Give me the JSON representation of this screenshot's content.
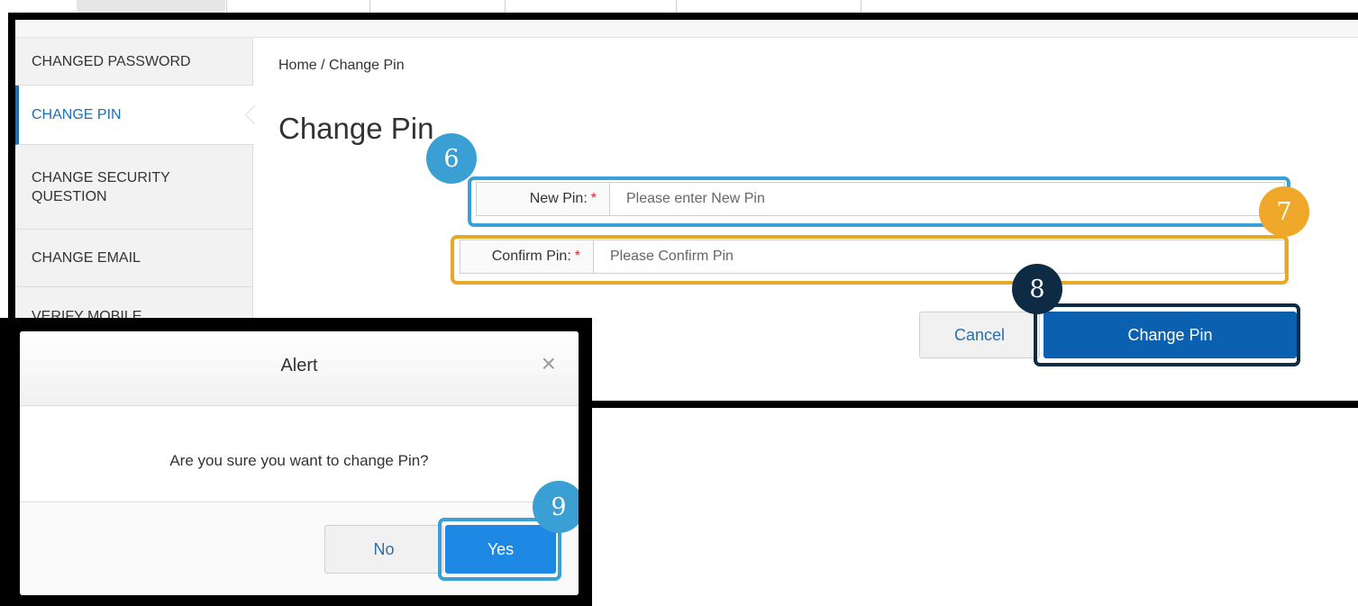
{
  "sidebar": {
    "items": [
      {
        "label": "CHANGED PASSWORD"
      },
      {
        "label": "CHANGE PIN"
      },
      {
        "label": "CHANGE SECURITY QUESTION"
      },
      {
        "label": "CHANGE EMAIL"
      },
      {
        "label": "VERIFY MOBILE"
      }
    ]
  },
  "breadcrumb": "Home / Change Pin",
  "page_title": "Change Pin",
  "form": {
    "new_pin": {
      "label": "New Pin:",
      "required_mark": "*",
      "placeholder": "Please enter New Pin",
      "value": ""
    },
    "confirm_pin": {
      "label": "Confirm Pin:",
      "required_mark": "*",
      "placeholder": "Please Confirm Pin",
      "value": ""
    },
    "cancel_label": "Cancel",
    "submit_label": "Change Pin"
  },
  "callouts": [
    "6",
    "7",
    "8",
    "9"
  ],
  "dialog": {
    "title": "Alert",
    "close_glyph": "×",
    "message": "Are you sure you want to change Pin?",
    "no_label": "No",
    "yes_label": "Yes"
  },
  "colors": {
    "accent": "#1c6fb8",
    "primary_button": "#0b61b0",
    "yes_button": "#1e88e5",
    "callout_blue": "#3a9fd3",
    "callout_orange": "#efa82a",
    "callout_navy": "#0e2b45",
    "required": "#d9262d"
  }
}
